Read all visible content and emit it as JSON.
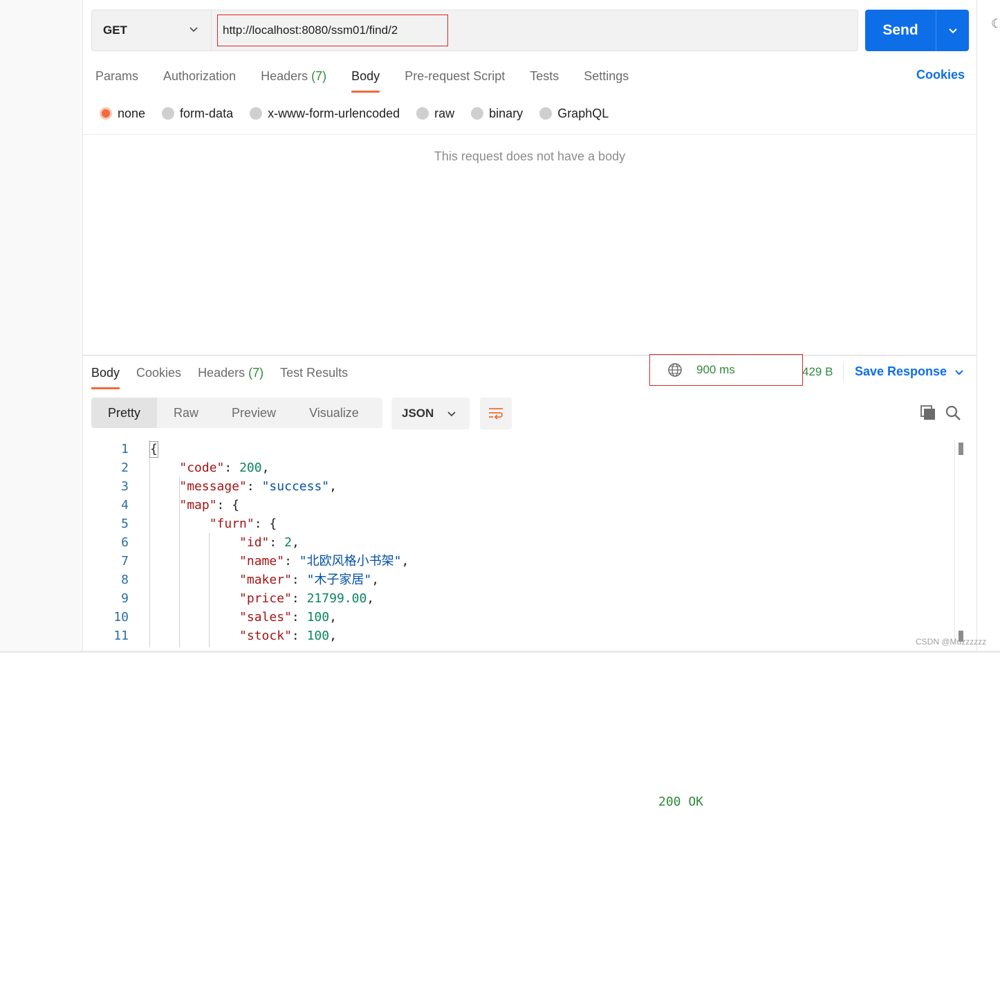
{
  "request": {
    "method": "GET",
    "url": "http://localhost:8080/ssm01/find/2",
    "send_label": "Send"
  },
  "request_tabs": [
    {
      "label": "Params",
      "count": ""
    },
    {
      "label": "Authorization",
      "count": ""
    },
    {
      "label": "Headers",
      "count": "(7)"
    },
    {
      "label": "Body",
      "count": "",
      "active": true
    },
    {
      "label": "Pre-request Script",
      "count": ""
    },
    {
      "label": "Tests",
      "count": ""
    },
    {
      "label": "Settings",
      "count": ""
    }
  ],
  "cookies_label": "Cookies",
  "body_types": [
    {
      "label": "none",
      "selected": true
    },
    {
      "label": "form-data"
    },
    {
      "label": "x-www-form-urlencoded"
    },
    {
      "label": "raw"
    },
    {
      "label": "binary"
    },
    {
      "label": "GraphQL"
    }
  ],
  "empty_body_message": "This request does not have a body",
  "response": {
    "tabs": [
      {
        "label": "Body",
        "count": "",
        "active": true
      },
      {
        "label": "Cookies",
        "count": ""
      },
      {
        "label": "Headers",
        "count": "(7)"
      },
      {
        "label": "Test Results",
        "count": ""
      }
    ],
    "status": "200 OK",
    "time": "900 ms",
    "size": "429 B",
    "save_label": "Save Response",
    "views": [
      "Pretty",
      "Raw",
      "Preview",
      "Visualize"
    ],
    "format": "JSON"
  },
  "code_lines": [
    {
      "n": "1",
      "html": "<span class=\"brace-box\">{</span>"
    },
    {
      "n": "2",
      "html": "    <span class=\"k\">\"code\"</span>: <span class=\"n\">200</span>,"
    },
    {
      "n": "3",
      "html": "    <span class=\"k\">\"message\"</span>: <span class=\"s\">\"success\"</span>,"
    },
    {
      "n": "4",
      "html": "    <span class=\"k\">\"map\"</span>: {"
    },
    {
      "n": "5",
      "html": "        <span class=\"k\">\"furn\"</span>: {"
    },
    {
      "n": "6",
      "html": "            <span class=\"k\">\"id\"</span>: <span class=\"n\">2</span>,"
    },
    {
      "n": "7",
      "html": "            <span class=\"k\">\"name\"</span>: <span class=\"s\">\"北欧风格小书架\"</span>,"
    },
    {
      "n": "8",
      "html": "            <span class=\"k\">\"maker\"</span>: <span class=\"s\">\"木子家居\"</span>,"
    },
    {
      "n": "9",
      "html": "            <span class=\"k\">\"price\"</span>: <span class=\"n\">21799.00</span>,"
    },
    {
      "n": "10",
      "html": "            <span class=\"k\">\"sales\"</span>: <span class=\"n\">100</span>,"
    },
    {
      "n": "11",
      "html": "            <span class=\"k\">\"stock\"</span>: <span class=\"n\">100</span>,"
    }
  ],
  "watermark": "CSDN @Muzzzzzz",
  "colors": {
    "accent": "#0d6ee8",
    "active_tab": "#f26b3a",
    "status_ok": "#2f8a3a",
    "highlight_box": "#e02424"
  }
}
